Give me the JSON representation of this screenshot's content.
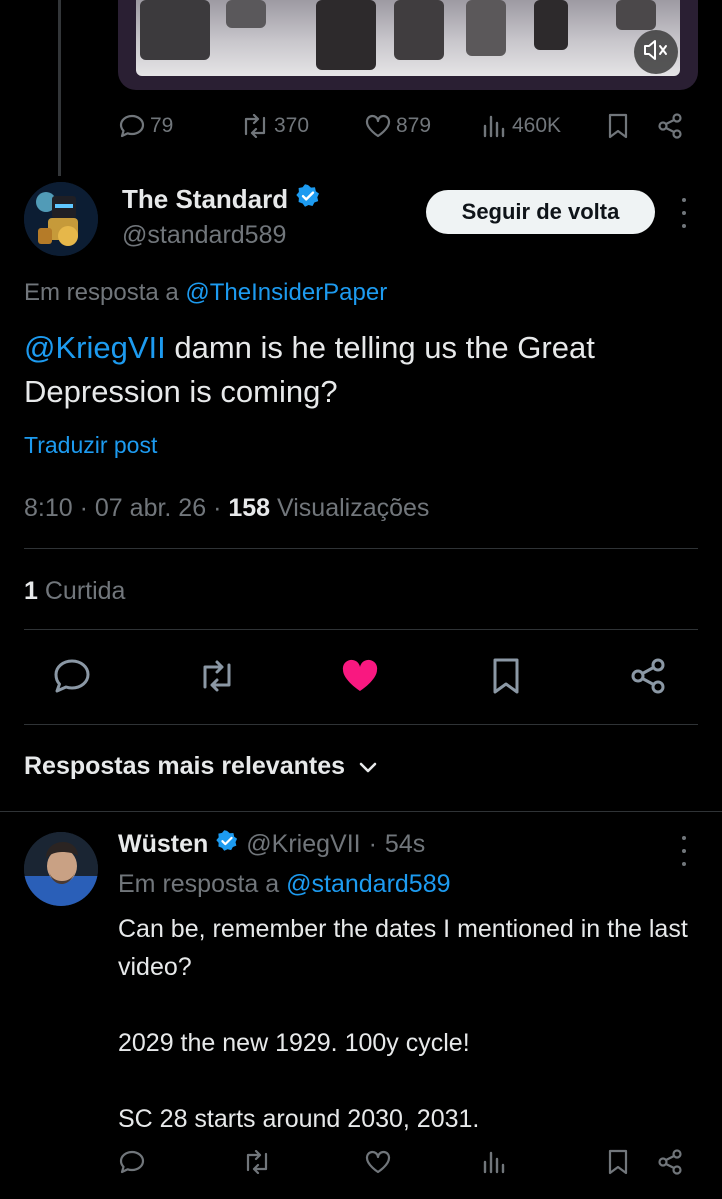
{
  "prev_post": {
    "stats": {
      "replies": "79",
      "reposts": "370",
      "likes": "879",
      "views": "460K"
    }
  },
  "post": {
    "display_name": "The Standard",
    "handle": "@standard589",
    "follow_label": "Seguir de volta",
    "reply_prefix": "Em resposta a",
    "reply_to": "@TheInsiderPaper",
    "mention": "@KriegVII",
    "text": " damn is he telling us the Great Depression is coming?",
    "translate_label": "Traduzir post",
    "time": "8:10",
    "date": "07 abr. 26",
    "views_count": "158",
    "views_label": "Visualizações",
    "likes_count": "1",
    "likes_label": "Curtida",
    "liked": true,
    "accent_like_color": "#f91880"
  },
  "sort": {
    "label": "Respostas mais relevantes"
  },
  "reply": {
    "display_name": "Wüsten",
    "handle": "@KriegVII",
    "time": "54s",
    "reply_prefix": "Em resposta a",
    "reply_to": "@standard589",
    "paragraphs": [
      "Can be, remember the dates I mentioned in the last video?",
      "2029 the new 1929. 100y cycle!",
      "SC 28 starts around 2030, 2031."
    ]
  },
  "colors": {
    "background": "#000000",
    "link": "#1d9bf0",
    "muted": "#71767b",
    "text": "#e7e9ea",
    "verified": "#1d9bf0"
  }
}
